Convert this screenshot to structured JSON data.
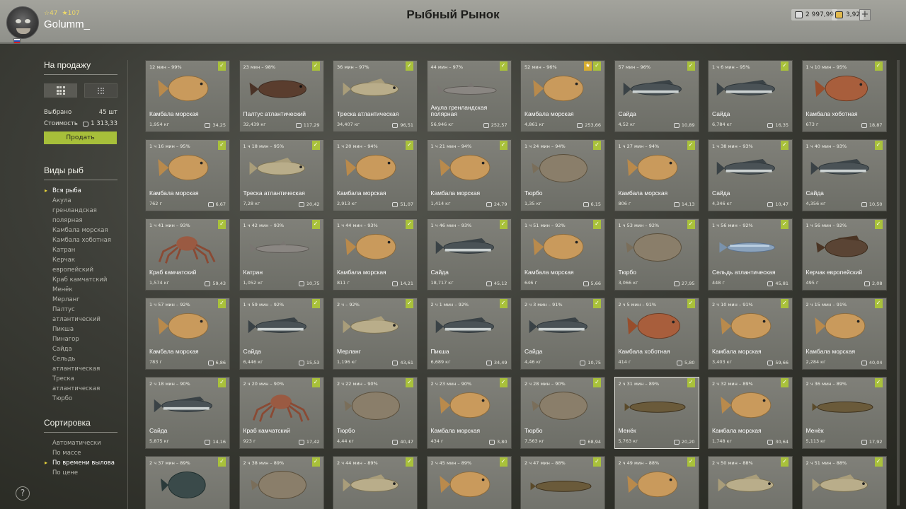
{
  "player": {
    "level": "47",
    "rating": "107",
    "name": "Golumm_"
  },
  "title": "Рыбный Рынок",
  "balance": {
    "silver": "2 997,99",
    "gold": "3,92"
  },
  "sidebar": {
    "for_sale_title": "На продажу",
    "selected_label": "Выбрано",
    "selected_value": "45 шт",
    "cost_label": "Стоимость",
    "cost_value": "1 313,33",
    "sell_label": "Продать",
    "species_title": "Виды рыб",
    "species": [
      "Вся рыба",
      "Акула гренландская полярная",
      "Камбала морская",
      "Камбала хоботная",
      "Катран",
      "Керчак европейский",
      "Краб камчатский",
      "Менёк",
      "Мерланг",
      "Палтус атлантический",
      "Пикша",
      "Пинагор",
      "Сайда",
      "Сельдь атлантическая",
      "Треска атлантическая",
      "Тюрбо"
    ],
    "sort_title": "Сортировка",
    "sort_options": [
      "Автоматически",
      "По массе",
      "По времени вылова",
      "По цене"
    ]
  },
  "colors": {
    "accent_green": "#a7bf3a",
    "star_gold": "#d7ad30",
    "selected_marker": "#e8d43a"
  },
  "cards": [
    {
      "time": "12 мин – 99%",
      "name": "Камбала морская",
      "weight": "1,954 кг",
      "price": "34,25",
      "kind": "flounder"
    },
    {
      "time": "23 мин – 98%",
      "name": "Палтус атлантический",
      "weight": "32,439 кг",
      "price": "117,29",
      "kind": "halibut"
    },
    {
      "time": "36 мин – 97%",
      "name": "Треска атлантическая",
      "weight": "34,407 кг",
      "price": "96,51",
      "kind": "cod"
    },
    {
      "time": "44 мин – 97%",
      "name": "Акула гренландская полярная",
      "weight": "56,946 кг",
      "price": "252,57",
      "kind": "shark"
    },
    {
      "time": "52 мин – 96%",
      "name": "Камбала морская",
      "weight": "4,861 кг",
      "price": "253,66",
      "kind": "flounder",
      "star": true
    },
    {
      "time": "57 мин – 96%",
      "name": "Сайда",
      "weight": "4,52 кг",
      "price": "10,89",
      "kind": "saithe"
    },
    {
      "time": "1 ч 6 мин – 95%",
      "name": "Сайда",
      "weight": "6,784 кг",
      "price": "16,35",
      "kind": "saithe"
    },
    {
      "time": "1 ч 10 мин – 95%",
      "name": "Камбала хоботная",
      "weight": "673 г",
      "price": "18,87",
      "kind": "redflounder"
    },
    {
      "time": "1 ч 16 мин – 95%",
      "name": "Камбала морская",
      "weight": "762 г",
      "price": "6,67",
      "kind": "flounder"
    },
    {
      "time": "1 ч 18 мин – 95%",
      "name": "Треска атлантическая",
      "weight": "7,28 кг",
      "price": "20,42",
      "kind": "cod"
    },
    {
      "time": "1 ч 20 мин – 94%",
      "name": "Камбала морская",
      "weight": "2,913 кг",
      "price": "51,07",
      "kind": "flounder"
    },
    {
      "time": "1 ч 21 мин – 94%",
      "name": "Камбала морская",
      "weight": "1,414 кг",
      "price": "24,79",
      "kind": "flounder"
    },
    {
      "time": "1 ч 24 мин – 94%",
      "name": "Тюрбо",
      "weight": "1,35 кг",
      "price": "6,15",
      "kind": "turbot"
    },
    {
      "time": "1 ч 27 мин – 94%",
      "name": "Камбала морская",
      "weight": "806 г",
      "price": "14,13",
      "kind": "flounder"
    },
    {
      "time": "1 ч 38 мин – 93%",
      "name": "Сайда",
      "weight": "4,346 кг",
      "price": "10,47",
      "kind": "saithe"
    },
    {
      "time": "1 ч 40 мин – 93%",
      "name": "Сайда",
      "weight": "4,356 кг",
      "price": "10,50",
      "kind": "saithe"
    },
    {
      "time": "1 ч 41 мин – 93%",
      "name": "Краб камчатский",
      "weight": "1,574 кг",
      "price": "59,43",
      "kind": "crab"
    },
    {
      "time": "1 ч 42 мин – 93%",
      "name": "Катран",
      "weight": "1,052 кг",
      "price": "10,75",
      "kind": "shark"
    },
    {
      "time": "1 ч 44 мин – 93%",
      "name": "Камбала морская",
      "weight": "811 г",
      "price": "14,21",
      "kind": "flounder"
    },
    {
      "time": "1 ч 46 мин – 93%",
      "name": "Сайда",
      "weight": "18,717 кг",
      "price": "45,12",
      "kind": "saithe"
    },
    {
      "time": "1 ч 51 мин – 92%",
      "name": "Камбала морская",
      "weight": "646 г",
      "price": "5,66",
      "kind": "flounder"
    },
    {
      "time": "1 ч 53 мин – 92%",
      "name": "Тюрбо",
      "weight": "3,066 кг",
      "price": "27,95",
      "kind": "turbot"
    },
    {
      "time": "1 ч 56 мин – 92%",
      "name": "Сельдь атлантическая",
      "weight": "448 г",
      "price": "45,81",
      "kind": "herring"
    },
    {
      "time": "1 ч 56 мин – 92%",
      "name": "Керчак европейский",
      "weight": "495 г",
      "price": "2,08",
      "kind": "sculpin"
    },
    {
      "time": "1 ч 57 мин – 92%",
      "name": "Камбала морская",
      "weight": "783 г",
      "price": "6,86",
      "kind": "flounder"
    },
    {
      "time": "1 ч 59 мин – 92%",
      "name": "Сайда",
      "weight": "6,446 кг",
      "price": "15,53",
      "kind": "saithe"
    },
    {
      "time": "2 ч – 92%",
      "name": "Мерланг",
      "weight": "1,196 кг",
      "price": "43,61",
      "kind": "cod"
    },
    {
      "time": "2 ч 1 мин – 92%",
      "name": "Пикша",
      "weight": "6,689 кг",
      "price": "34,49",
      "kind": "saithe"
    },
    {
      "time": "2 ч 3 мин – 91%",
      "name": "Сайда",
      "weight": "4,46 кг",
      "price": "10,75",
      "kind": "saithe"
    },
    {
      "time": "2 ч 5 мин – 91%",
      "name": "Камбала хоботная",
      "weight": "414 г",
      "price": "5,80",
      "kind": "redflounder"
    },
    {
      "time": "2 ч 10 мин – 91%",
      "name": "Камбала морская",
      "weight": "3,403 кг",
      "price": "59,66",
      "kind": "flounder"
    },
    {
      "time": "2 ч 15 мин – 91%",
      "name": "Камбала морская",
      "weight": "2,284 кг",
      "price": "40,04",
      "kind": "flounder"
    },
    {
      "time": "2 ч 18 мин – 90%",
      "name": "Сайда",
      "weight": "5,875 кг",
      "price": "14,16",
      "kind": "saithe"
    },
    {
      "time": "2 ч 20 мин – 90%",
      "name": "Краб камчатский",
      "weight": "923 г",
      "price": "17,42",
      "kind": "crab"
    },
    {
      "time": "2 ч 22 мин – 90%",
      "name": "Тюрбо",
      "weight": "4,44 кг",
      "price": "40,47",
      "kind": "turbot"
    },
    {
      "time": "2 ч 23 мин – 90%",
      "name": "Камбала морская",
      "weight": "434 г",
      "price": "3,80",
      "kind": "flounder"
    },
    {
      "time": "2 ч 28 мин – 90%",
      "name": "Тюрбо",
      "weight": "7,563 кг",
      "price": "68,94",
      "kind": "turbot"
    },
    {
      "time": "2 ч 31 мин – 89%",
      "name": "Менёк",
      "weight": "5,763 кг",
      "price": "20,20",
      "kind": "eel",
      "selected": true
    },
    {
      "time": "2 ч 32 мин – 89%",
      "name": "Камбала морская",
      "weight": "1,748 кг",
      "price": "30,64",
      "kind": "flounder"
    },
    {
      "time": "2 ч 36 мин – 89%",
      "name": "Менёк",
      "weight": "5,113 кг",
      "price": "17,92",
      "kind": "eel"
    },
    {
      "time": "2 ч 37 мин – 89%",
      "name": "",
      "weight": "",
      "price": "",
      "kind": "lumpfish"
    },
    {
      "time": "2 ч 38 мин – 89%",
      "name": "",
      "weight": "",
      "price": "",
      "kind": "turbot"
    },
    {
      "time": "2 ч 44 мин – 89%",
      "name": "",
      "weight": "",
      "price": "",
      "kind": "cod"
    },
    {
      "time": "2 ч 45 мин – 89%",
      "name": "",
      "weight": "",
      "price": "",
      "kind": "flounder"
    },
    {
      "time": "2 ч 47 мин – 88%",
      "name": "",
      "weight": "",
      "price": "",
      "kind": "eel"
    },
    {
      "time": "2 ч 49 мин – 88%",
      "name": "",
      "weight": "",
      "price": "",
      "kind": "flounder"
    },
    {
      "time": "2 ч 50 мин – 88%",
      "name": "",
      "weight": "",
      "price": "",
      "kind": "cod"
    },
    {
      "time": "2 ч 51 мин – 88%",
      "name": "",
      "weight": "",
      "price": "",
      "kind": "cod"
    }
  ]
}
